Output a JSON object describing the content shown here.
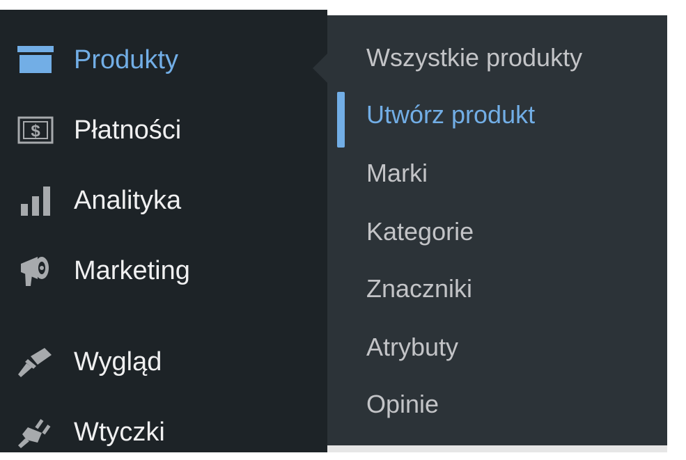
{
  "sidebar": {
    "items": [
      {
        "label": "Produkty",
        "icon": "archive-icon",
        "current": true
      },
      {
        "label": "Płatności",
        "icon": "dollar-bill-icon"
      },
      {
        "label": "Analityka",
        "icon": "bar-chart-icon"
      },
      {
        "label": "Marketing",
        "icon": "megaphone-icon"
      },
      {
        "label": "Wygląd",
        "icon": "paintbrush-icon"
      },
      {
        "label": "Wtyczki",
        "icon": "plugin-icon"
      }
    ]
  },
  "submenu": {
    "items": [
      {
        "label": "Wszystkie produkty"
      },
      {
        "label": "Utwórz produkt",
        "current": true
      },
      {
        "label": "Marki"
      },
      {
        "label": "Kategorie"
      },
      {
        "label": "Znaczniki"
      },
      {
        "label": "Atrybuty"
      },
      {
        "label": "Opinie"
      }
    ]
  },
  "colors": {
    "sidebar_bg": "#1d2327",
    "submenu_bg": "#2c3338",
    "accent": "#72aee6",
    "text": "#f0f0f1",
    "submenu_text": "#c3c4c7",
    "icon": "#a7aaad"
  }
}
